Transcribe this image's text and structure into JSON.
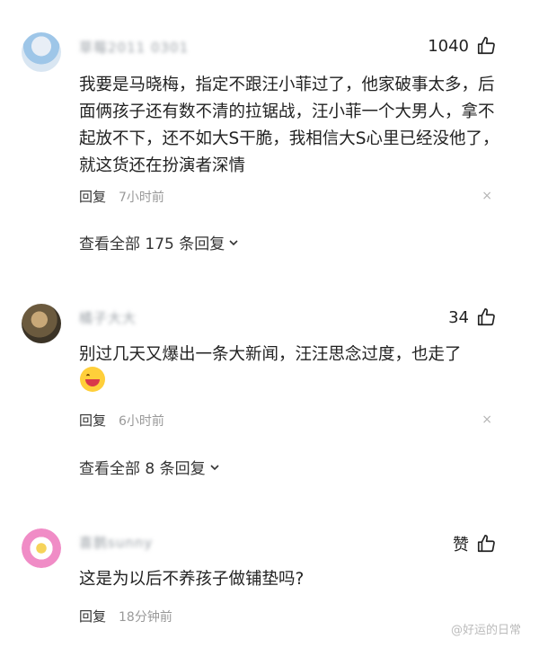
{
  "comments": [
    {
      "username": "草莓2011 0301",
      "likes": "1040",
      "text": "我要是马晓梅，指定不跟汪小菲过了，他家破事太多，后面俩孩子还有数不清的拉锯战，汪小菲一个大男人，拿不起放不下，还不如大S干脆，我相信大S心里已经没他了，就这货还在扮演者深情",
      "reply_label": "回复",
      "time": "7小时前",
      "close": "×",
      "view_all": "查看全部 175 条回复"
    },
    {
      "username": "橘子大大",
      "likes": "34",
      "text": "别过几天又爆出一条大新闻，汪汪思念过度，也走了",
      "emoji": "grinning-face-emoji",
      "reply_label": "回复",
      "time": "6小时前",
      "close": "×",
      "view_all": "查看全部 8 条回复"
    },
    {
      "username": "喜鹊sunny",
      "likes": "赞",
      "text": "这是为以后不养孩子做铺垫吗?",
      "reply_label": "回复",
      "time": "18分钟前"
    }
  ],
  "watermark": "@好运的日常",
  "icons": {
    "like": "thumbs-up-icon",
    "close": "close-icon",
    "chevron": "chevron-down-icon"
  }
}
